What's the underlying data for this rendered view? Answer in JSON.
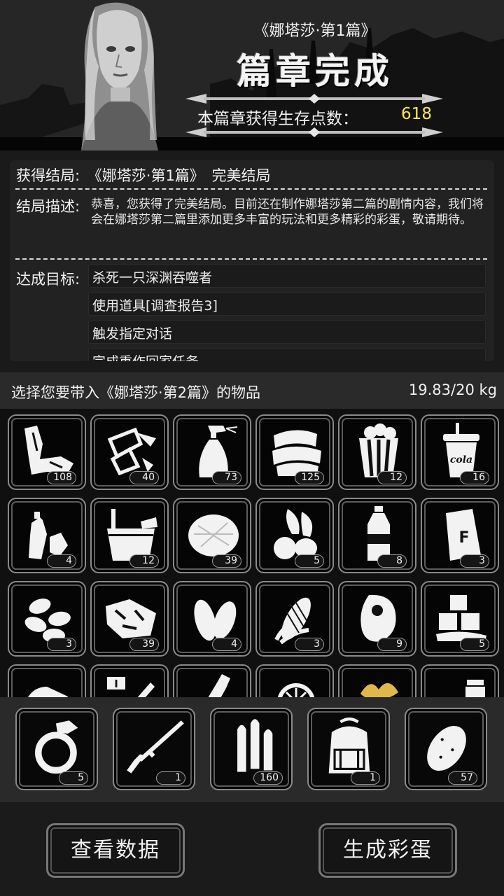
{
  "header": {
    "subtitle": "《娜塔莎·第1篇》",
    "title": "篇章完成",
    "points_label": "本篇章获得生存点数：",
    "points_value": "618"
  },
  "ending": {
    "label": "获得结局:",
    "chapter": "《娜塔莎·第1篇》",
    "name": "完美结局",
    "desc_label": "结局描述:",
    "desc_text": "恭喜，您获得了完美结局。目前还在制作娜塔莎第二篇的剧情内容，我们将会在娜塔莎第二篇里添加更多丰富的玩法和更多精彩的彩蛋，敬请期待。",
    "goals_label": "达成目标:",
    "goals": [
      "杀死一只深渊吞噬者",
      "使用道具[调查报告3]",
      "触发指定对话",
      "完成重作回家任务"
    ]
  },
  "inventory": {
    "title": "选择您要带入《娜塔莎·第2篇》的物品",
    "weight": "19.83/20 kg",
    "items": [
      {
        "icon": "rags-icon",
        "count": "108"
      },
      {
        "icon": "paper-icon",
        "count": "40"
      },
      {
        "icon": "spray-bottle-icon",
        "count": "73"
      },
      {
        "icon": "towels-icon",
        "count": "125"
      },
      {
        "icon": "popcorn-icon",
        "count": "12"
      },
      {
        "icon": "cola-cup-icon",
        "count": "16",
        "label": "cola"
      },
      {
        "icon": "plastic-bottles-icon",
        "count": "4"
      },
      {
        "icon": "bucket-icon",
        "count": "12"
      },
      {
        "icon": "cotton-icon",
        "count": "39"
      },
      {
        "icon": "vegetables-icon",
        "count": "5"
      },
      {
        "icon": "water-bottle-icon",
        "count": "8"
      },
      {
        "icon": "flour-sack-icon",
        "count": "3",
        "label": "F"
      },
      {
        "icon": "nuts-icon",
        "count": "3"
      },
      {
        "icon": "meat-chunk-icon",
        "count": "39"
      },
      {
        "icon": "seeds-icon",
        "count": "4"
      },
      {
        "icon": "corn-icon",
        "count": "3"
      },
      {
        "icon": "steak-icon",
        "count": "9"
      },
      {
        "icon": "ice-cubes-icon",
        "count": "5"
      },
      {
        "icon": "pipe-icon",
        "count": ""
      },
      {
        "icon": "syringe-icon",
        "count": "",
        "label": "I"
      },
      {
        "icon": "wine-bottle-icon",
        "count": ""
      },
      {
        "icon": "citrus-icon",
        "count": ""
      },
      {
        "icon": "tobacco-leaf-icon",
        "count": ""
      },
      {
        "icon": "jar-icon",
        "count": ""
      }
    ]
  },
  "equipment": [
    {
      "icon": "ring-icon",
      "count": "5"
    },
    {
      "icon": "rifle-icon",
      "count": "1"
    },
    {
      "icon": "bullets-icon",
      "count": "160"
    },
    {
      "icon": "backpack-icon",
      "count": "1"
    },
    {
      "icon": "potato-icon",
      "count": "57"
    }
  ],
  "buttons": {
    "view_data": "查看数据",
    "make_egg": "生成彩蛋"
  },
  "colors": {
    "points": "#ffe94d",
    "accent_leaf": "#e0b84a"
  }
}
